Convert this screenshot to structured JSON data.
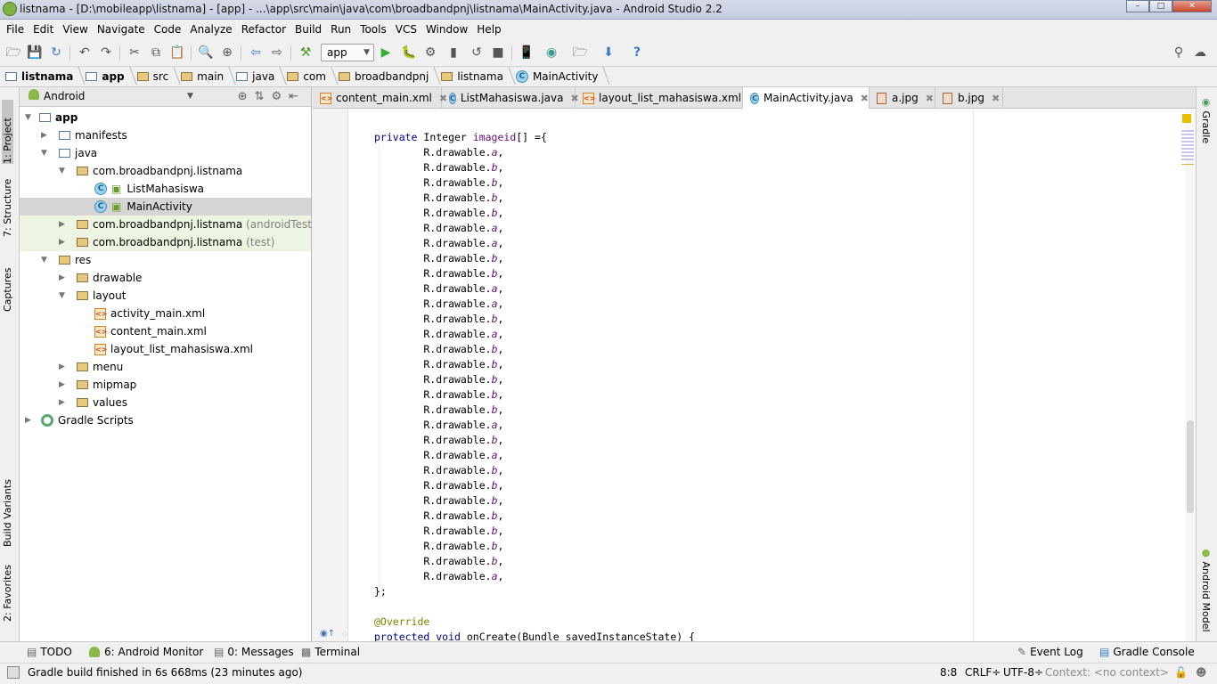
{
  "window": {
    "title": "listnama - [D:\\mobileapp\\listnama] - [app] - ...\\app\\src\\main\\java\\com\\broadbandpnj\\listnama\\MainActivity.java - Android Studio 2.2"
  },
  "menu": [
    "File",
    "Edit",
    "View",
    "Navigate",
    "Code",
    "Analyze",
    "Refactor",
    "Build",
    "Run",
    "Tools",
    "VCS",
    "Window",
    "Help"
  ],
  "toolbar": {
    "run_config": "app"
  },
  "breadcrumbs": [
    "listnama",
    "app",
    "src",
    "main",
    "java",
    "com",
    "broadbandpnj",
    "listnama",
    "MainActivity"
  ],
  "left_tools": [
    "1: Project",
    "7: Structure",
    "Captures",
    "Build Variants",
    "2: Favorites"
  ],
  "right_tools": [
    "Gradle",
    "Android Model"
  ],
  "project_panel": {
    "view": "Android"
  },
  "tree": [
    {
      "label": "app",
      "suffix": ""
    },
    {
      "label": "manifests",
      "suffix": ""
    },
    {
      "label": "java",
      "suffix": ""
    },
    {
      "label": "com.broadbandpnj.listnama",
      "suffix": ""
    },
    {
      "label": "ListMahasiswa",
      "suffix": ""
    },
    {
      "label": "MainActivity",
      "suffix": ""
    },
    {
      "label": "com.broadbandpnj.listnama",
      "suffix": "(androidTest)"
    },
    {
      "label": "com.broadbandpnj.listnama",
      "suffix": "(test)"
    },
    {
      "label": "res",
      "suffix": ""
    },
    {
      "label": "drawable",
      "suffix": ""
    },
    {
      "label": "layout",
      "suffix": ""
    },
    {
      "label": "activity_main.xml",
      "suffix": ""
    },
    {
      "label": "content_main.xml",
      "suffix": ""
    },
    {
      "label": "layout_list_mahasiswa.xml",
      "suffix": ""
    },
    {
      "label": "menu",
      "suffix": ""
    },
    {
      "label": "mipmap",
      "suffix": ""
    },
    {
      "label": "values",
      "suffix": ""
    },
    {
      "label": "Gradle Scripts",
      "suffix": ""
    }
  ],
  "tabs": [
    "content_main.xml",
    "ListMahasiswa.java",
    "layout_list_mahasiswa.xml",
    "MainActivity.java",
    "a.jpg",
    "b.jpg"
  ],
  "code": {
    "decl": {
      "kw": "private",
      "type": "Integer",
      "field": "imageid",
      "rest": "[] ={"
    },
    "prefix": "R.drawable.",
    "items": [
      "a",
      "b",
      "b",
      "b",
      "b",
      "a",
      "a",
      "b",
      "b",
      "a",
      "a",
      "b",
      "a",
      "b",
      "b",
      "b",
      "b",
      "b",
      "a",
      "b",
      "a",
      "b",
      "b",
      "b",
      "b",
      "b",
      "b",
      "b",
      "a"
    ],
    "close": "};",
    "annotation": "@Override",
    "method": {
      "kw1": "protected",
      "kw2": "void",
      "sig": "onCreate(Bundle savedInstanceState) {"
    }
  },
  "bottom_tools": [
    "TODO",
    "6: Android Monitor",
    "0: Messages",
    "Terminal",
    "Event Log",
    "Gradle Console"
  ],
  "status": {
    "message": "Gradle build finished in 6s 668ms (23 minutes ago)",
    "position": "8:8",
    "line_sep": "CRLF÷",
    "encoding": "UTF-8÷",
    "context": "Context: <no context>"
  }
}
